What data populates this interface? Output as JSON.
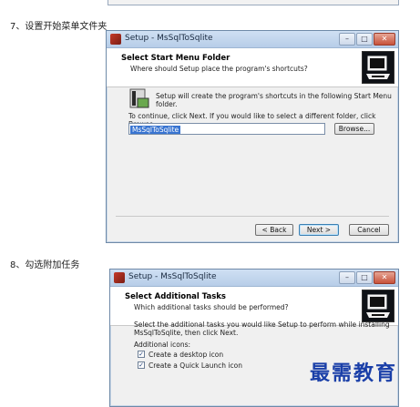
{
  "step7": "7、设置开始菜单文件夹",
  "step8": "8、勾选附加任务",
  "watermark": "最需教育",
  "window_title": "Setup - MsSqlToSqlite",
  "window_buttons": {
    "minimize": "–",
    "maximize": "□",
    "close": "✕"
  },
  "dialog1": {
    "heading": "Select Start Menu Folder",
    "subheading": "Where should Setup place the program's shortcuts?",
    "info": "Setup will create the program's shortcuts in the following Start Menu folder.",
    "instruction": "To continue, click Next. If you would like to select a different folder, click Browse.",
    "folder_value": "MsSqlToSqlite",
    "browse_label": "Browse...",
    "back_label": "< Back",
    "next_label": "Next >",
    "cancel_label": "Cancel"
  },
  "dialog2": {
    "heading": "Select Additional Tasks",
    "subheading": "Which additional tasks should be performed?",
    "intro_line1": "Select the additional tasks you would like Setup to perform while installing",
    "intro_line2": "MsSqlToSqlite, then click Next.",
    "section_label": "Additional icons:",
    "tasks": [
      {
        "label": "Create a desktop icon",
        "checked": true
      },
      {
        "label": "Create a Quick Launch icon",
        "checked": true
      }
    ]
  },
  "colors": {
    "selection": "#3874d1",
    "watermark": "#1a3fa8",
    "titlebar": "#b7cde8"
  },
  "icons": [
    "setup-app-icon",
    "installer-computer-logo",
    "start-menu-folder-icon",
    "checkbox-checked-icon"
  ]
}
